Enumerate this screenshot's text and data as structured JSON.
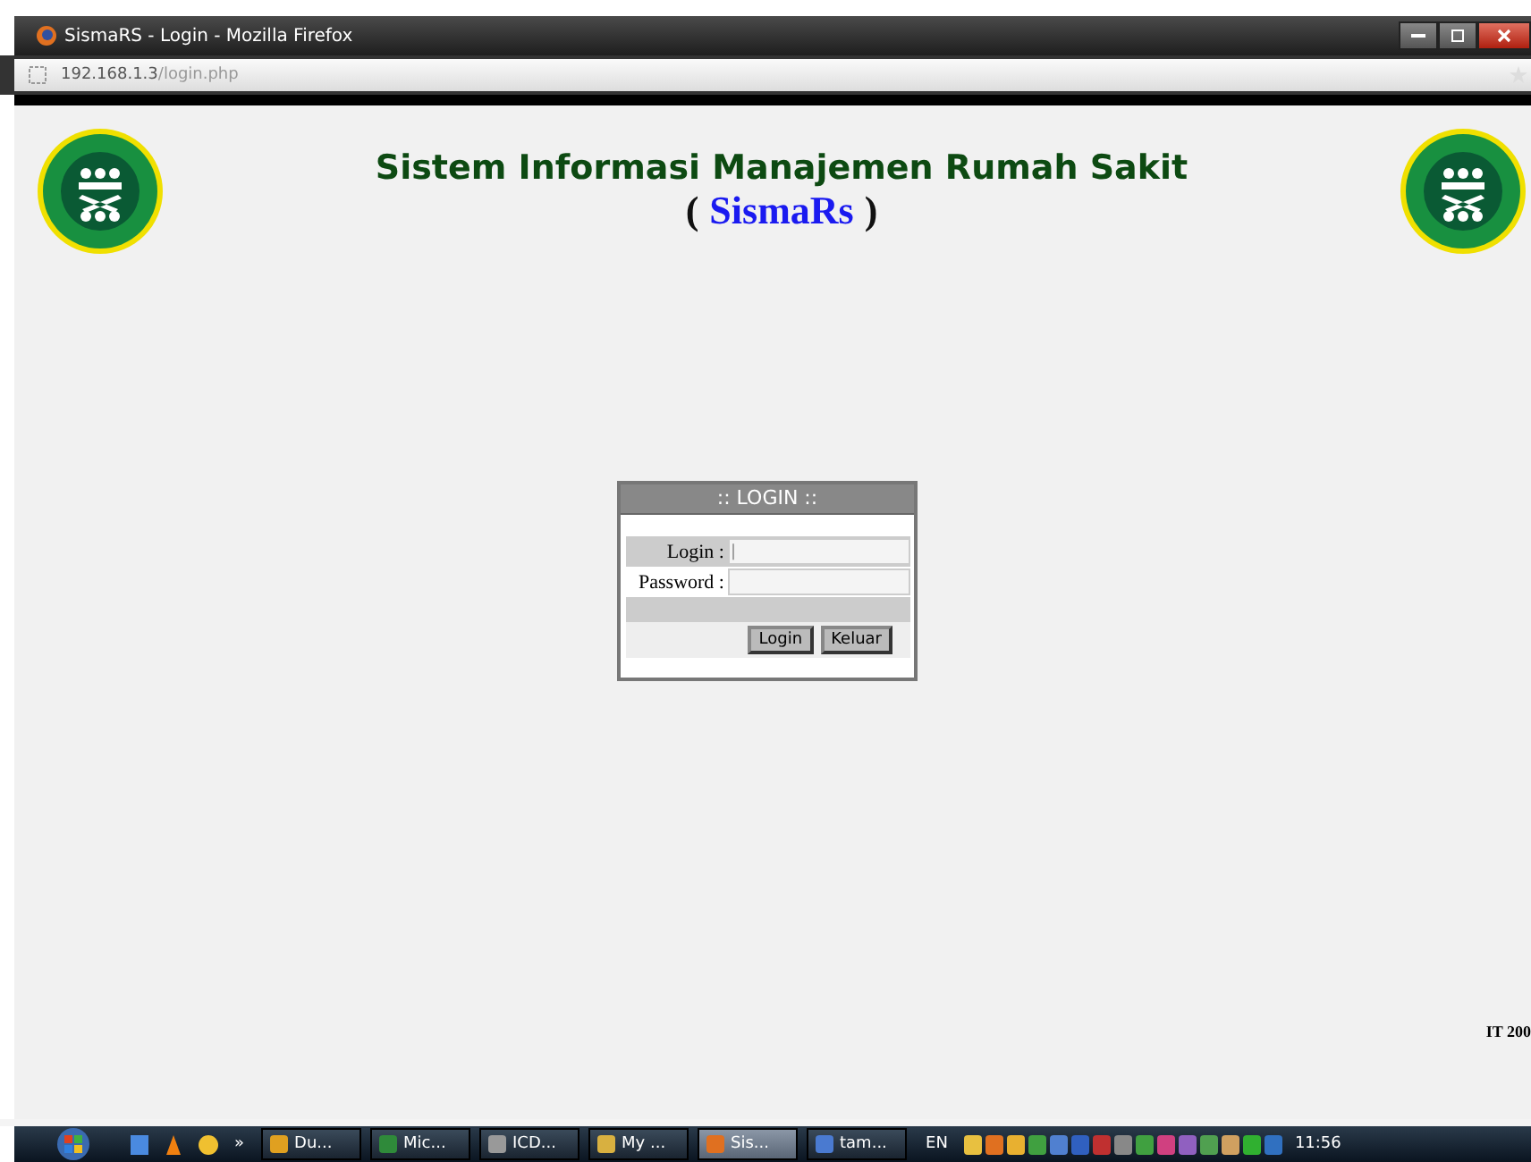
{
  "window": {
    "title": "SismaRS - Login - Mozilla Firefox"
  },
  "address_bar": {
    "host": "192.168.1.3",
    "path": "/login.php"
  },
  "page": {
    "title": "Sistem Informasi Manajemen Rumah Sakit",
    "subtitle_open": "(",
    "subtitle_name": "SismaRs",
    "subtitle_close": ")",
    "footer": "IT 200"
  },
  "login_box": {
    "heading": ":: LOGIN ::",
    "fields": [
      {
        "label": "Login :",
        "value": "|"
      },
      {
        "label": "Password :"
      }
    ],
    "buttons": [
      "Login",
      "Keluar"
    ]
  },
  "taskbar": {
    "more": "»",
    "tasks": [
      {
        "label": "Du...",
        "selected": false
      },
      {
        "label": "Mic...",
        "selected": false
      },
      {
        "label": "ICD...",
        "selected": false
      },
      {
        "label": "My ...",
        "selected": false
      },
      {
        "label": "Sis...",
        "selected": true
      },
      {
        "label": "tam...",
        "selected": false
      }
    ],
    "language": "EN",
    "clock": "11:56"
  }
}
